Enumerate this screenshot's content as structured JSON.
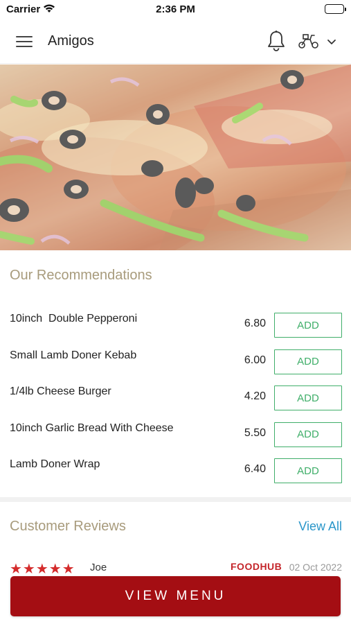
{
  "status_bar": {
    "carrier": "Carrier",
    "time": "2:36 PM"
  },
  "header": {
    "title": "Amigos",
    "icons": [
      "menu-icon",
      "bell-icon",
      "scooter-icon",
      "chevron-down-icon"
    ]
  },
  "recommendations": {
    "heading": "Our Recommendations",
    "items": [
      {
        "name": "10inch  Double Pepperoni",
        "price": "6.80",
        "button": "ADD"
      },
      {
        "name": "Small Lamb Doner Kebab",
        "price": "6.00",
        "button": "ADD"
      },
      {
        "name": "1/4lb Cheese Burger",
        "price": "4.20",
        "button": "ADD"
      },
      {
        "name": "10inch Garlic Bread With Cheese",
        "price": "5.50",
        "button": "ADD"
      },
      {
        "name": "Lamb Doner Wrap",
        "price": "6.40",
        "button": "ADD"
      }
    ]
  },
  "reviews": {
    "heading": "Customer Reviews",
    "view_all": "View All",
    "first": {
      "stars": "★★★★★",
      "rating": 5,
      "reviewer": "Joe",
      "source": "FOODHUB",
      "date": "02 Oct 2022"
    }
  },
  "footer": {
    "button": "VIEW MENU"
  },
  "colors": {
    "accent_red": "#a40e13",
    "add_green": "#3fae69",
    "heading_tan": "#a89b7c",
    "link_blue": "#2a96c9"
  }
}
